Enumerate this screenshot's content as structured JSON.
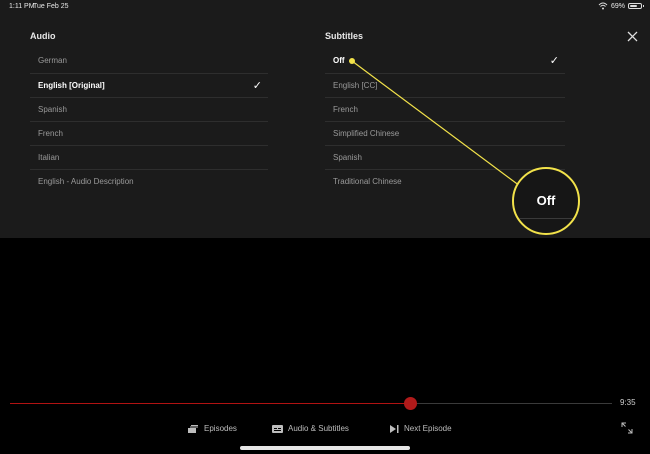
{
  "status": {
    "time": "1:11 PM",
    "date": "Tue Feb 25",
    "battery": "69%",
    "battery_level": 0.69
  },
  "audio": {
    "title": "Audio",
    "items": [
      "German",
      "English [Original]",
      "Spanish",
      "French",
      "Italian",
      "English - Audio Description"
    ],
    "selected_index": 1
  },
  "subtitles": {
    "title": "Subtitles",
    "items": [
      "Off",
      "English [CC]",
      "French",
      "Simplified Chinese",
      "Spanish",
      "Traditional Chinese"
    ],
    "selected_index": 0
  },
  "callout": {
    "label": "Off",
    "color": "#f2e24a"
  },
  "player": {
    "progress_fraction": 0.665,
    "time_remaining": "9:35",
    "controls": {
      "episodes": "Episodes",
      "audio_subtitles": "Audio & Subtitles",
      "next_episode": "Next Episode"
    }
  },
  "colors": {
    "accent_red": "#b11a1a",
    "highlight": "#f2e24a",
    "panel": "#1b1b1b"
  }
}
